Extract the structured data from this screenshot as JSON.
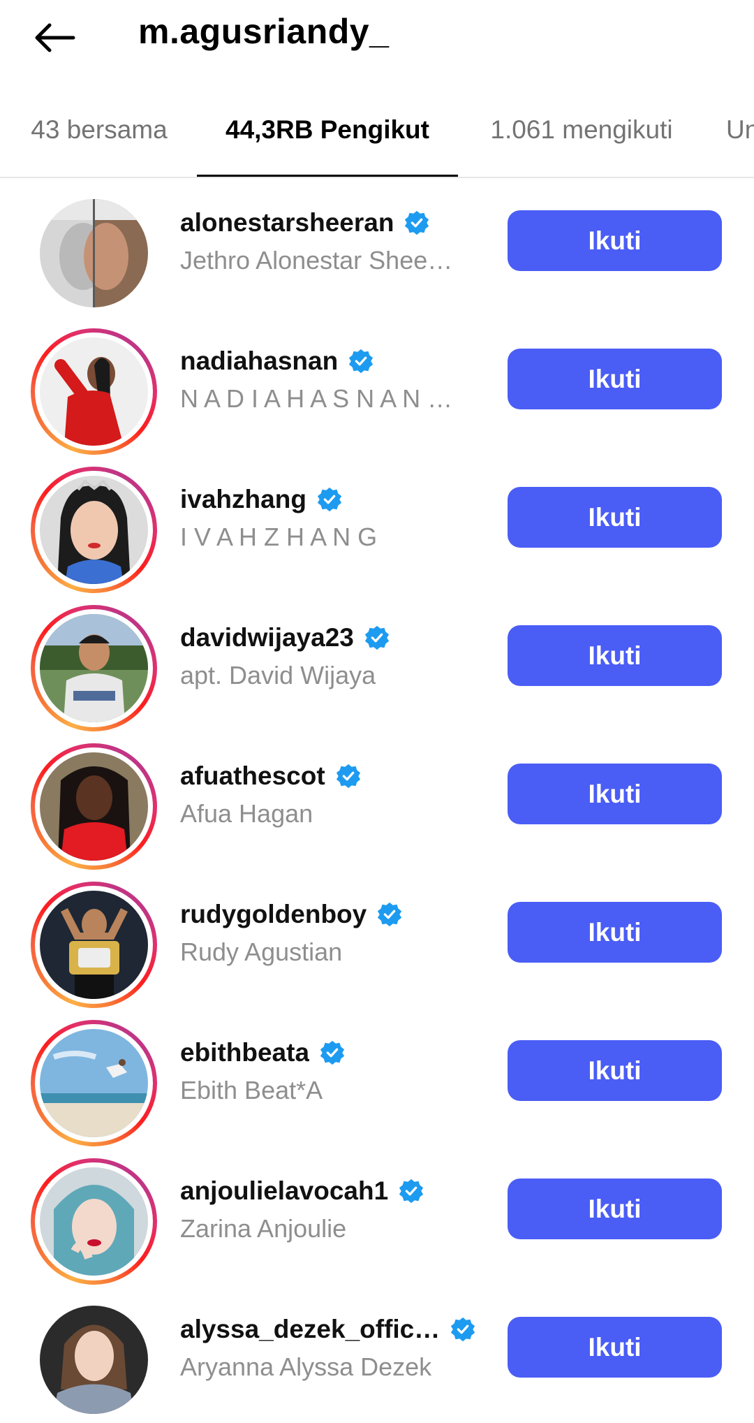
{
  "header": {
    "title": "m.agusriandy_",
    "back_icon": "arrow-left-icon"
  },
  "tabs": [
    {
      "label": "43 bersama",
      "active": false
    },
    {
      "label": "44,3RB Pengikut",
      "active": true
    },
    {
      "label": "1.061 mengikuti",
      "active": false
    },
    {
      "label": "Un",
      "active": false
    }
  ],
  "colors": {
    "accent": "#4a5df5",
    "verified": "#1d9bf0",
    "secondary_text": "#8e8e8e"
  },
  "followers": [
    {
      "username": "alonestarsheeran",
      "full_name": "Jethro Alonestar Shee…",
      "verified": true,
      "button": "Ikuti",
      "story_ring": false
    },
    {
      "username": "nadiahasnan",
      "full_name": "N A D I A H A S N A N …",
      "verified": true,
      "button": "Ikuti",
      "story_ring": true
    },
    {
      "username": "ivahzhang",
      "full_name": "I V A H Z H A N G",
      "verified": true,
      "button": "Ikuti",
      "story_ring": true
    },
    {
      "username": "davidwijaya23",
      "full_name": "apt. David Wijaya",
      "verified": true,
      "button": "Ikuti",
      "story_ring": true
    },
    {
      "username": "afuathescot",
      "full_name": "Afua Hagan",
      "verified": true,
      "button": "Ikuti",
      "story_ring": true
    },
    {
      "username": "rudygoldenboy",
      "full_name": "Rudy Agustian",
      "verified": true,
      "button": "Ikuti",
      "story_ring": true
    },
    {
      "username": "ebithbeata",
      "full_name": "Ebith Beat*A",
      "verified": true,
      "button": "Ikuti",
      "story_ring": true
    },
    {
      "username": "anjoulielavocah1",
      "full_name": "Zarina Anjoulie",
      "verified": true,
      "button": "Ikuti",
      "story_ring": true
    },
    {
      "username": "alyssa_dezek_offic…",
      "full_name": "Aryanna Alyssa Dezek",
      "verified": true,
      "button": "Ikuti",
      "story_ring": false
    }
  ]
}
